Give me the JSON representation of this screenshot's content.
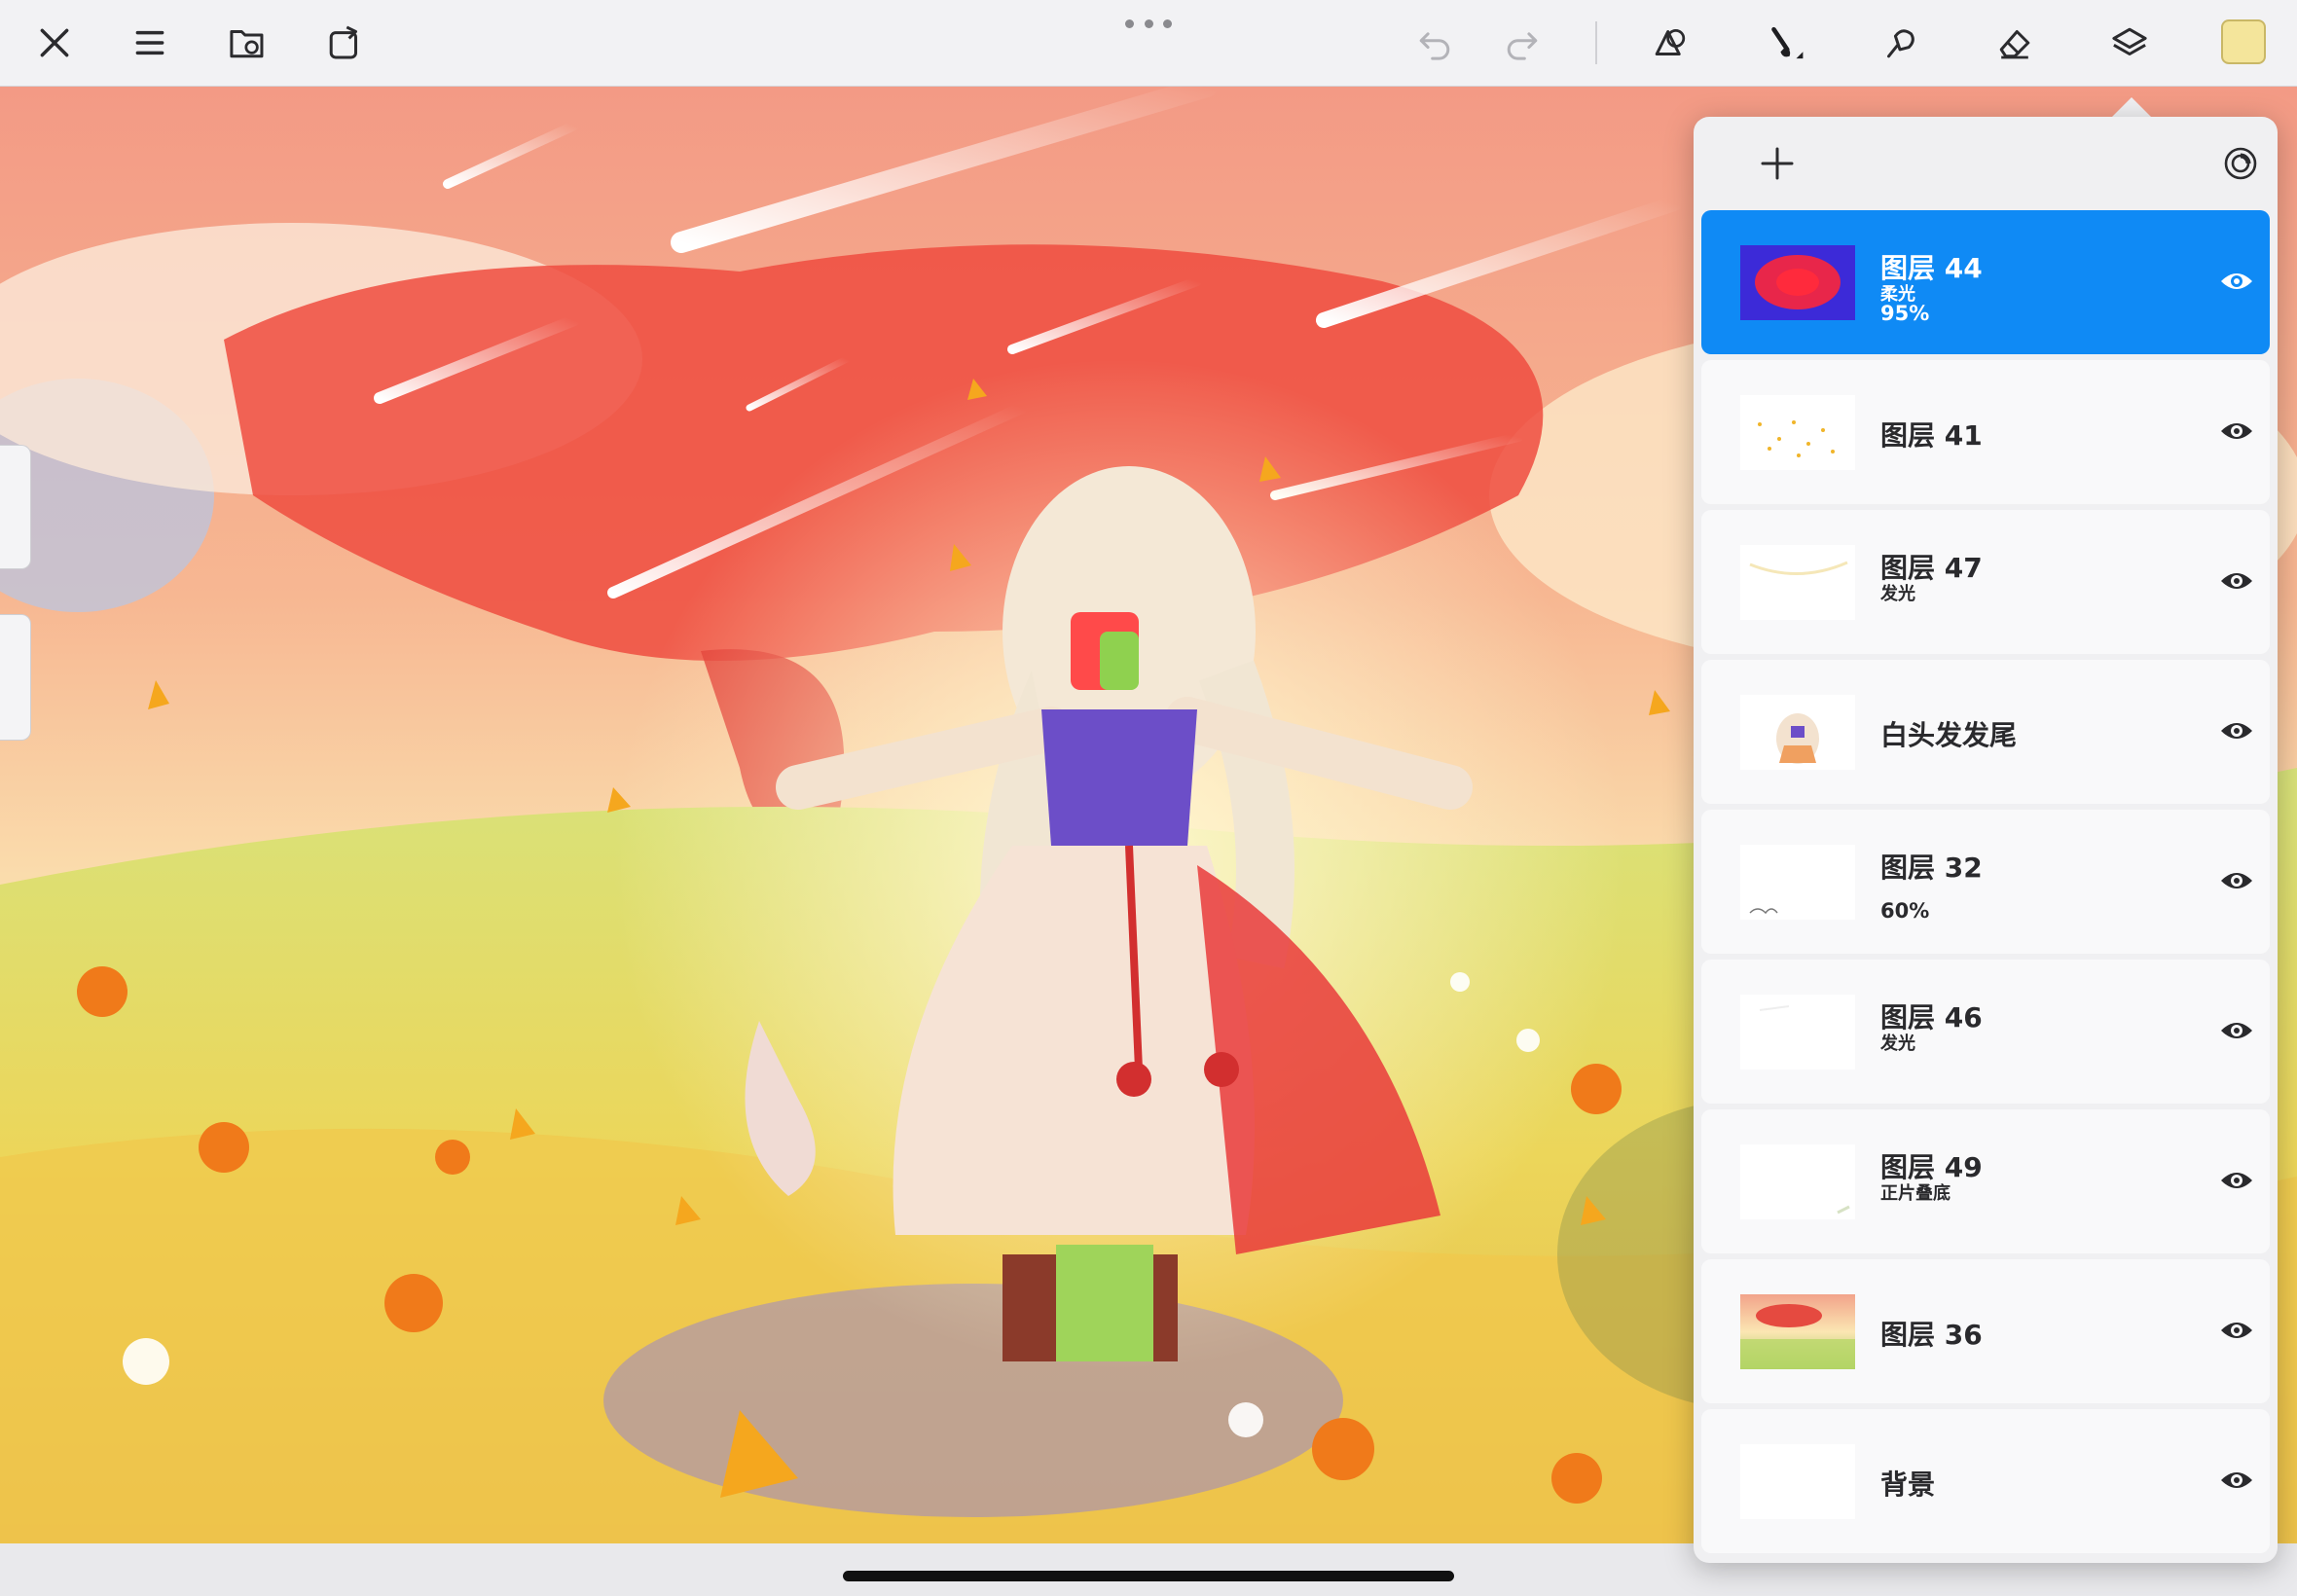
{
  "toolbar": {
    "left_icons": [
      "close-icon",
      "menu-icon",
      "gallery-icon",
      "share-icon"
    ],
    "right_icons": [
      "undo-icon",
      "redo-icon",
      "adjust-icon",
      "brush-icon",
      "smudge-icon",
      "eraser-icon",
      "layers-icon"
    ],
    "current_color": "#f4e59b"
  },
  "layers": {
    "add_icon": "plus-icon",
    "settings_icon": "layer-settings-icon",
    "items": [
      {
        "name": "图层 44",
        "blend": "柔光",
        "opacity": "95%",
        "selected": true,
        "visible": true
      },
      {
        "name": "图层 41",
        "blend": "",
        "opacity": "",
        "selected": false,
        "visible": true
      },
      {
        "name": "图层 47",
        "blend": "发光",
        "opacity": "",
        "selected": false,
        "visible": true
      },
      {
        "name": "白头发发尾",
        "blend": "",
        "opacity": "",
        "selected": false,
        "visible": true
      },
      {
        "name": "图层 32",
        "blend": "",
        "opacity": "60%",
        "selected": false,
        "visible": true
      },
      {
        "name": "图层 46",
        "blend": "发光",
        "opacity": "",
        "selected": false,
        "visible": true
      },
      {
        "name": "图层 49",
        "blend": "正片叠底",
        "opacity": "",
        "selected": false,
        "visible": true
      },
      {
        "name": "图层 36",
        "blend": "",
        "opacity": "",
        "selected": false,
        "visible": true
      },
      {
        "name": "背景",
        "blend": "",
        "opacity": "",
        "selected": false,
        "visible": true
      }
    ]
  },
  "colors": {
    "accent": "#0f8af5",
    "panel": "#f0f0f2"
  }
}
